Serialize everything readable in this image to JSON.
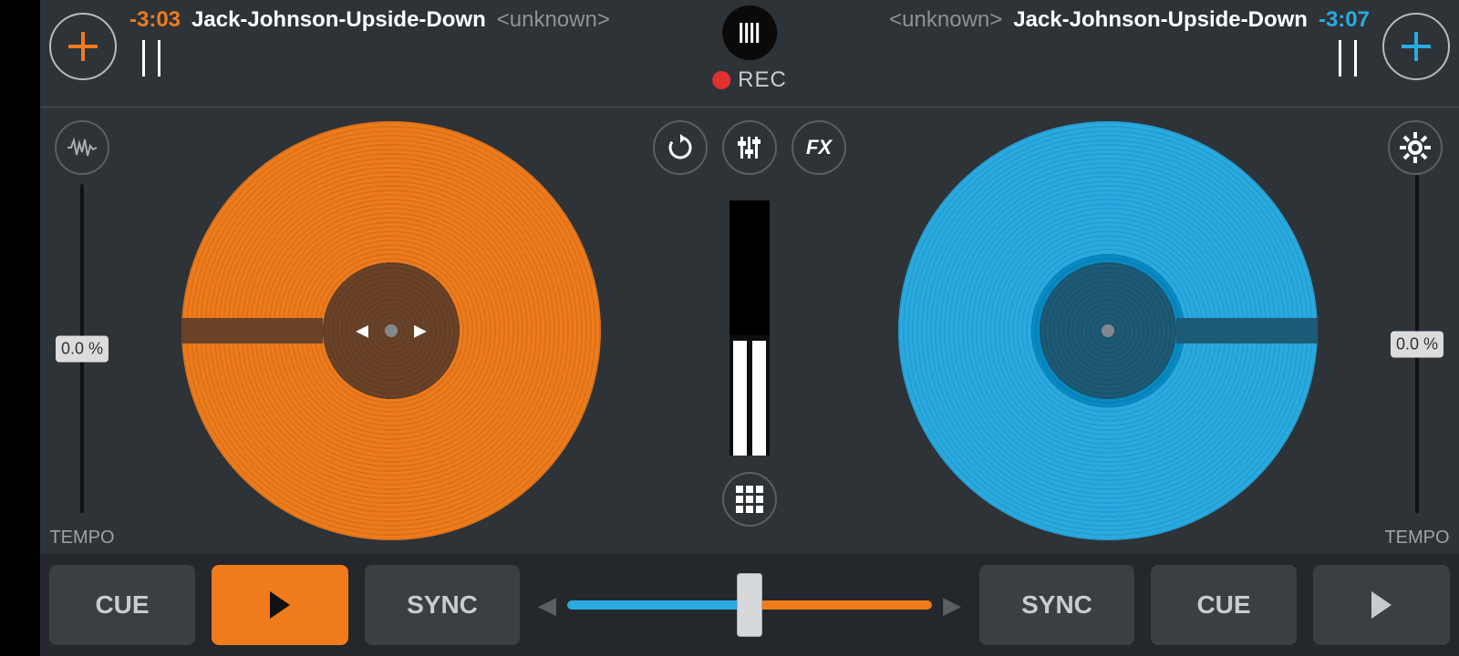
{
  "colors": {
    "deck_a": "#ef7b1b",
    "deck_b": "#29abe2",
    "bg": "#2e3338",
    "bottom": "#24282c"
  },
  "header": {
    "rec_label": "REC",
    "deck_a": {
      "time": "-3:03",
      "title": "Jack-Johnson-Upside-Down",
      "artist": "<unknown>"
    },
    "deck_b": {
      "time": "-3:07",
      "title": "Jack-Johnson-Upside-Down",
      "artist": "<unknown>"
    }
  },
  "center_buttons": {
    "loop_icon": "loop",
    "eq_icon": "eq",
    "fx_label": "FX",
    "grid_icon": "grid"
  },
  "tempo": {
    "label": "TEMPO",
    "a": {
      "value": "0.0 %"
    },
    "b": {
      "value": "0.0 %"
    }
  },
  "mixer": {
    "vu_top_black_ratio": 0.53
  },
  "bottom": {
    "cue_label": "CUE",
    "sync_label": "SYNC",
    "deck_a_playing": true,
    "deck_b_playing": false,
    "crossfader_position": 0.5
  }
}
